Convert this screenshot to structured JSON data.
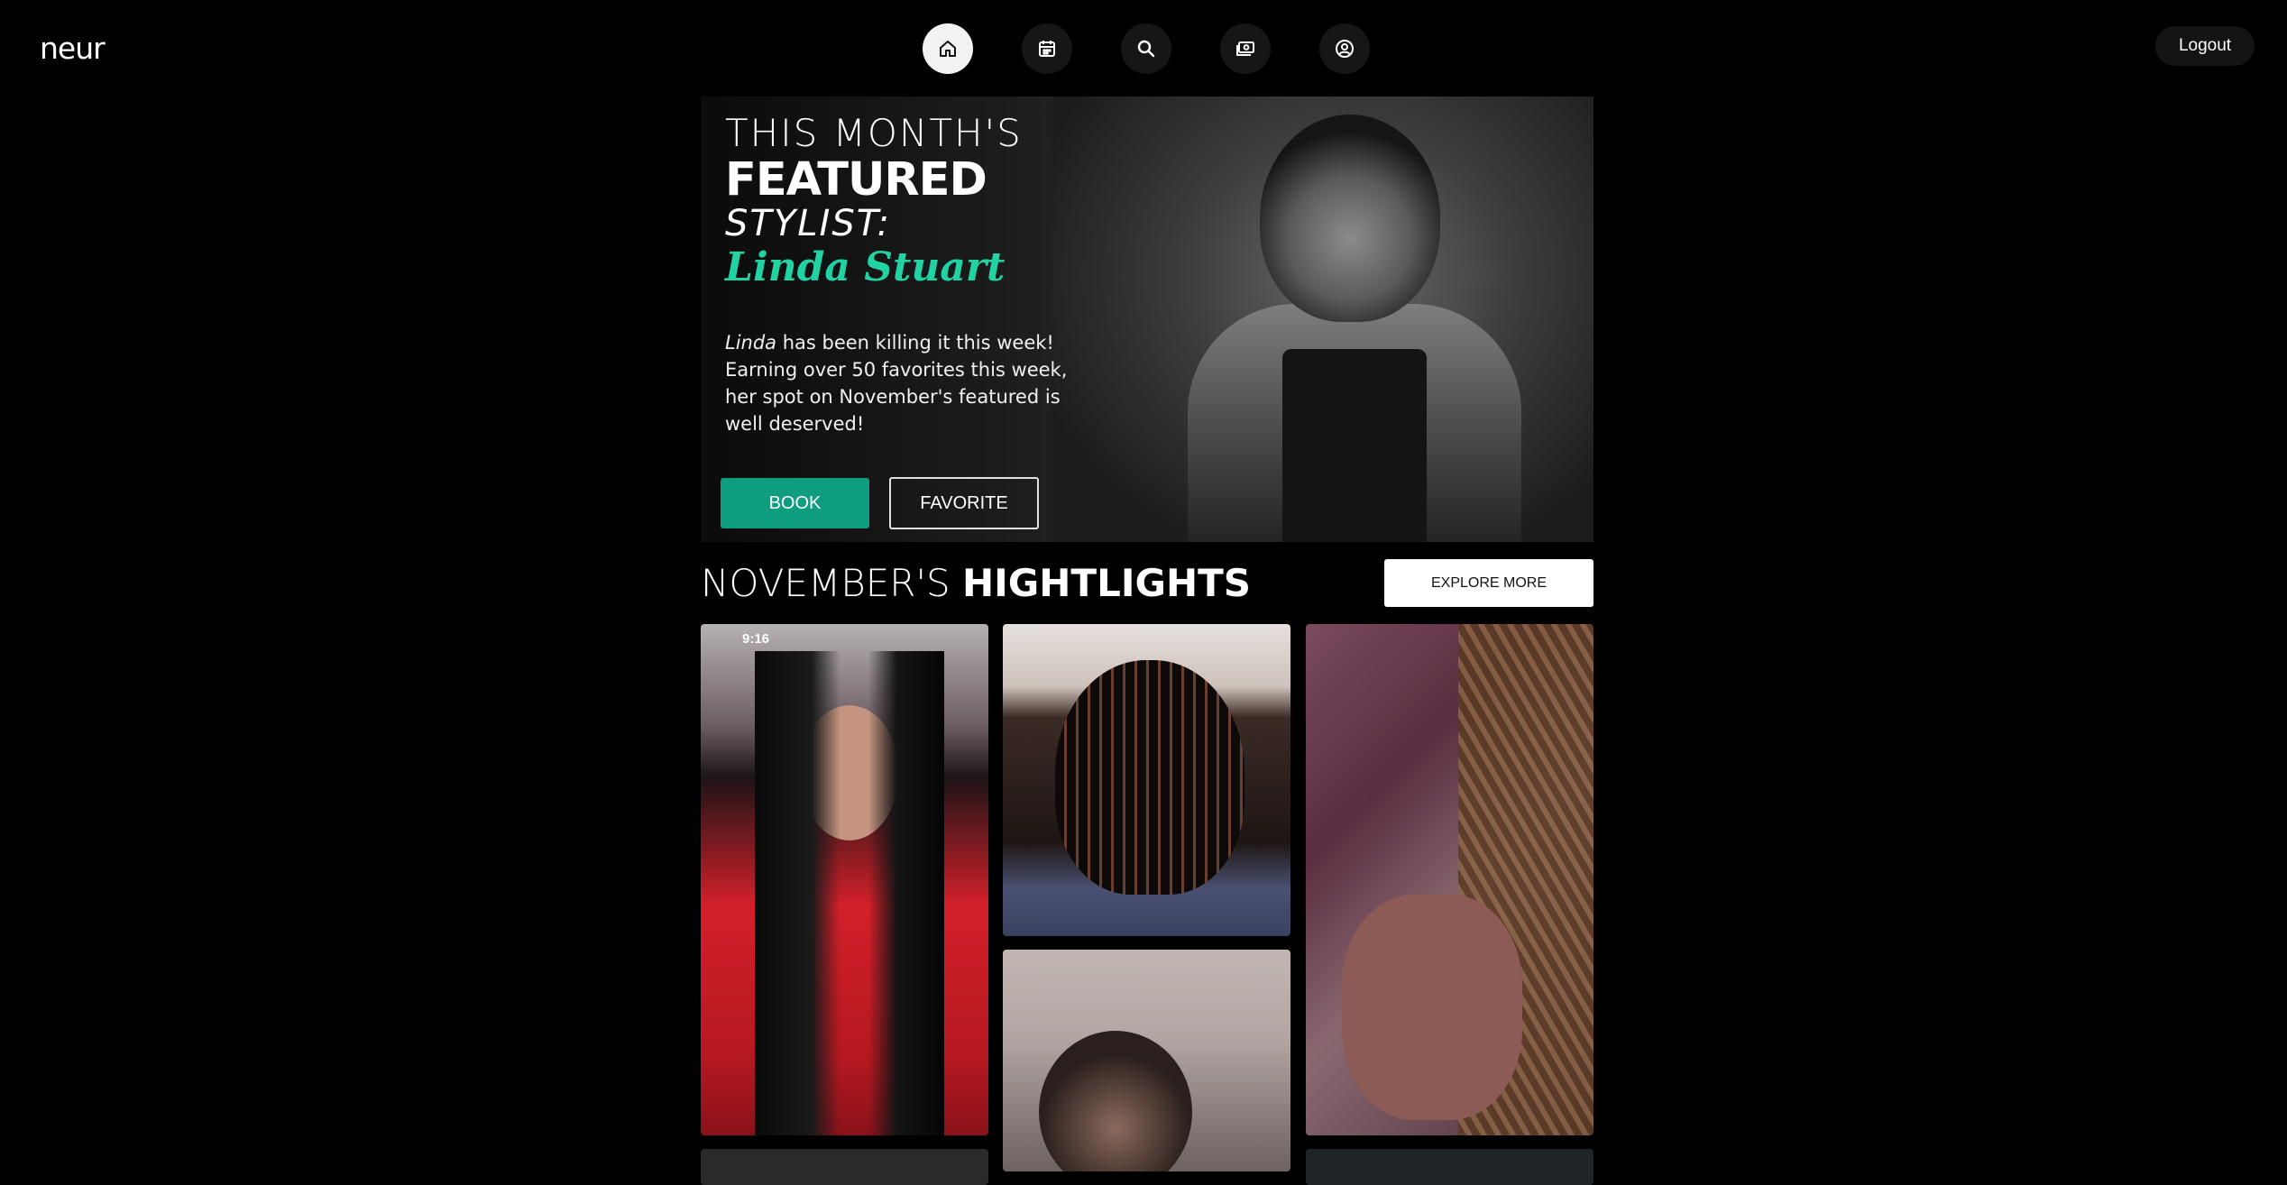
{
  "header": {
    "logo": "neur",
    "nav": [
      {
        "name": "home-icon",
        "active": true
      },
      {
        "name": "calendar-icon",
        "active": false
      },
      {
        "name": "search-icon",
        "active": false
      },
      {
        "name": "payments-icon",
        "active": false
      },
      {
        "name": "profile-icon",
        "active": false
      }
    ],
    "logout_label": "Logout"
  },
  "hero": {
    "line1": "THIS MONTH'S",
    "line2": "FEATURED",
    "line3": "STYLIST:",
    "stylist_name": "Linda Stuart",
    "desc_name": "Linda",
    "desc_rest": " has been killing it this week! Earning over 50 favorites this week, her spot on November's featured is well deserved!",
    "book_label": "BOOK",
    "favorite_label": "FAVORITE",
    "accent_color": "#21d2a3",
    "book_color": "#0e9d7e"
  },
  "highlights": {
    "title_thin": "NOVEMBER'S ",
    "title_bold": "HIGHTLIGHTS",
    "explore_label": "EXPLORE MORE",
    "tile1_time": "9:16"
  }
}
